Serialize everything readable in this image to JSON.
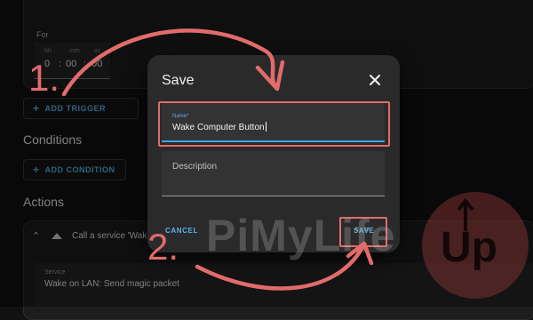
{
  "trigger": {
    "for_label": "For",
    "time": {
      "hh_label": "hh",
      "mm_label": "mm",
      "ss_label": "ss",
      "hh": "0",
      "mm": "00",
      "ss": "00"
    },
    "add_trigger_label": "ADD TRIGGER"
  },
  "conditions": {
    "title": "Conditions",
    "add_condition_label": "ADD CONDITION"
  },
  "actions": {
    "title": "Actions",
    "action_title": "Call a service 'Wake",
    "service_label": "Service",
    "service_value": "Wake on LAN: Send magic packet"
  },
  "dialog": {
    "title": "Save",
    "name_label": "Name*",
    "name_value": "Wake Computer Button",
    "description_label": "Description",
    "cancel_label": "CANCEL",
    "save_label": "SAVE"
  },
  "annotations": {
    "step1": "1.",
    "step2": "2."
  },
  "watermark": {
    "text": "PiMyLife",
    "text2": "Up"
  },
  "colors": {
    "accent": "#3ea6e6",
    "highlight": "#e26b6b",
    "dialog_bg": "#2a2a2a"
  }
}
